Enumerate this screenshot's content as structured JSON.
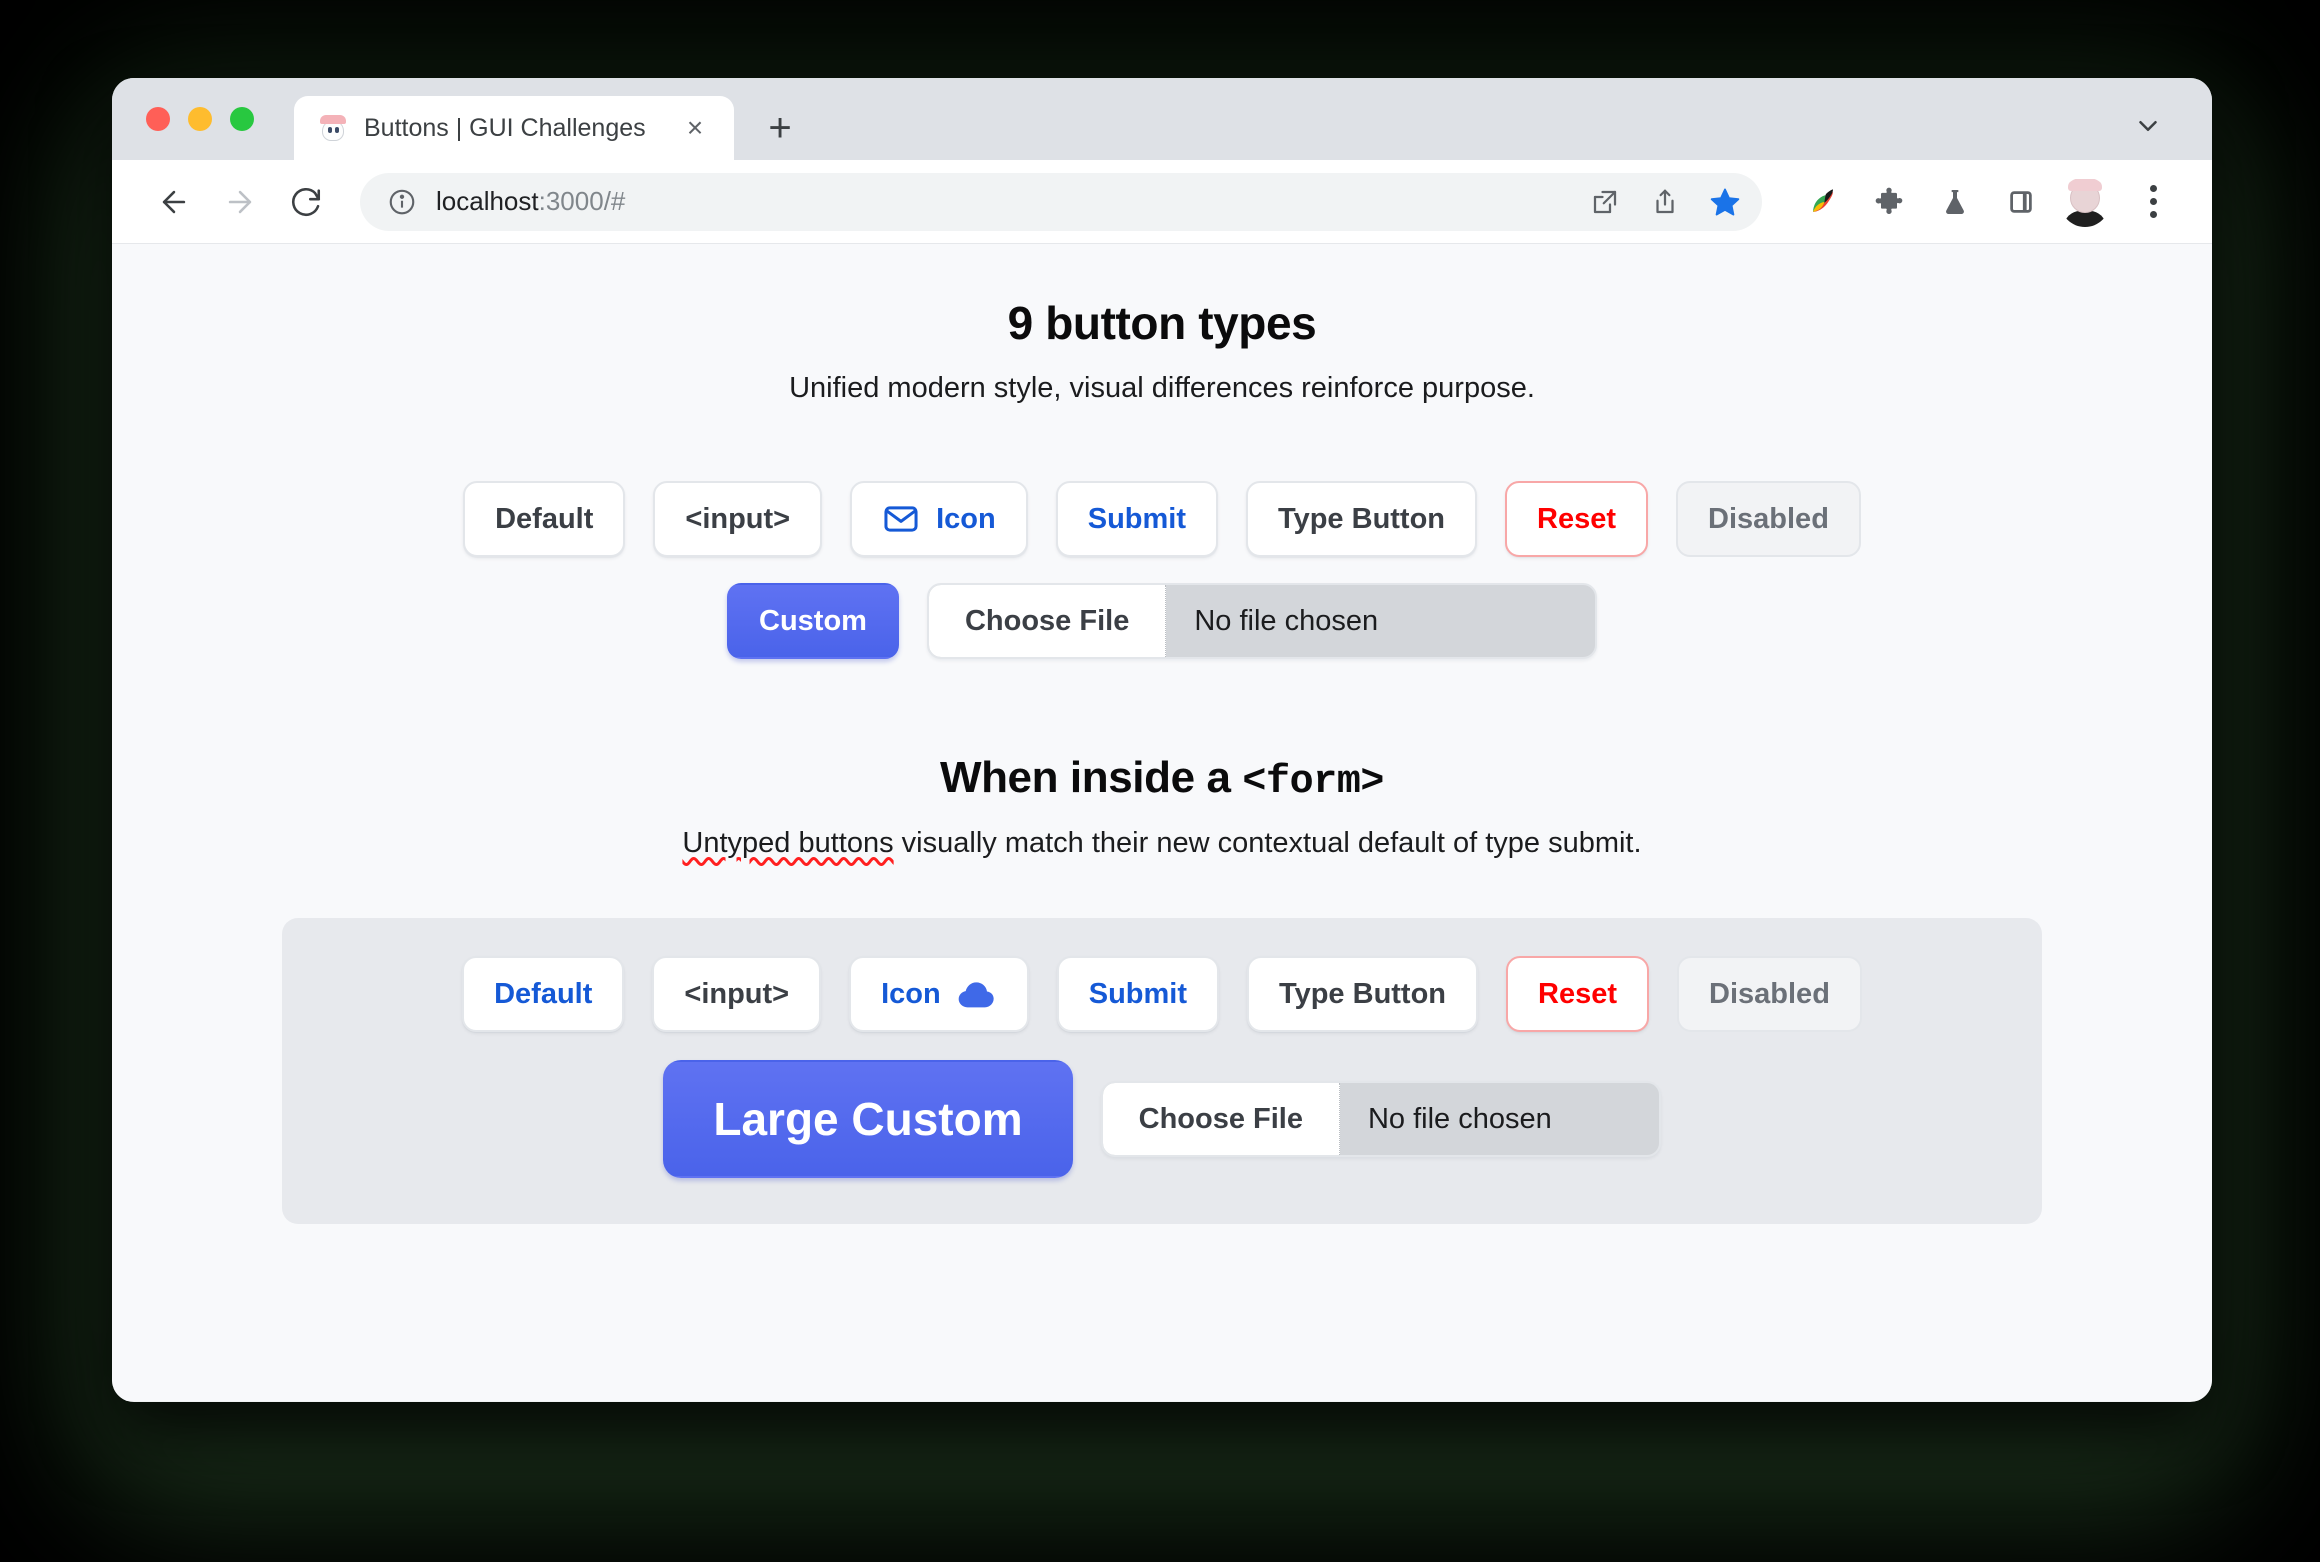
{
  "browser": {
    "tab": {
      "title": "Buttons | GUI Challenges",
      "favicon": "ghost-favicon",
      "close_label": "×",
      "new_tab_label": "+"
    },
    "omnibox": {
      "url_host": "localhost",
      "url_rest": ":3000/#",
      "info_icon": "info-circle-icon"
    },
    "nav": {
      "back": "←",
      "forward": "→",
      "reload": "↻"
    },
    "toolbar_icons": [
      "open-in-new-icon",
      "share-icon",
      "bookmark-star-icon",
      "extension-colorful-icon",
      "puzzle-piece-icon",
      "flask-icon",
      "side-panel-icon",
      "profile-avatar-icon",
      "three-dot-menu-icon"
    ]
  },
  "page": {
    "title": "9 button types",
    "subtitle": "Unified modern style, visual differences reinforce purpose.",
    "row1": [
      {
        "label": "Default",
        "style": "default"
      },
      {
        "label": "<input>",
        "style": "default"
      },
      {
        "label": "Icon",
        "style": "blue",
        "icon": "mail-icon",
        "icon_position": "left"
      },
      {
        "label": "Submit",
        "style": "blue"
      },
      {
        "label": "Type Button",
        "style": "default"
      },
      {
        "label": "Reset",
        "style": "red"
      },
      {
        "label": "Disabled",
        "style": "disabled"
      }
    ],
    "row2": {
      "custom_label": "Custom",
      "file": {
        "choose_label": "Choose File",
        "filename": "No file chosen"
      }
    }
  },
  "form_section": {
    "title_prefix": "When inside a ",
    "title_mono": "<form>",
    "subtitle_spell": "Untyped buttons",
    "subtitle_rest": " visually match their new contextual default of type submit.",
    "row1": [
      {
        "label": "Default",
        "style": "blue"
      },
      {
        "label": "<input>",
        "style": "default"
      },
      {
        "label": "Icon",
        "style": "blue",
        "icon": "cloud-icon",
        "icon_position": "right"
      },
      {
        "label": "Submit",
        "style": "blue"
      },
      {
        "label": "Type Button",
        "style": "default"
      },
      {
        "label": "Reset",
        "style": "red"
      },
      {
        "label": "Disabled",
        "style": "disabled"
      }
    ],
    "row2": {
      "custom_label": "Large Custom",
      "file": {
        "choose_label": "Choose File",
        "filename": "No file chosen"
      }
    }
  },
  "colors": {
    "accent_blue": "#4a63ea",
    "link_blue": "#1559d6",
    "danger_red": "#ff0000",
    "danger_border": "#f8a7a7",
    "page_bg": "#f8f9fb",
    "panel_bg": "#e7e9ed",
    "text_dark": "#3b3f45"
  }
}
